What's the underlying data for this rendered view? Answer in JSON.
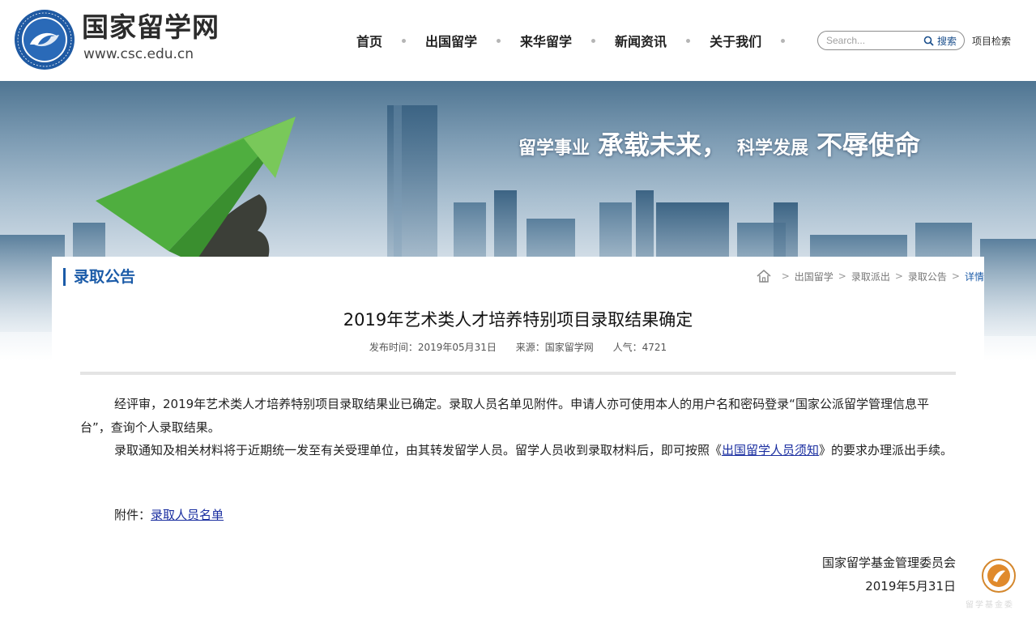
{
  "header": {
    "logo_title": "国家留学网",
    "logo_url": "www.csc.edu.cn",
    "nav": [
      "首页",
      "出国留学",
      "来华留学",
      "新闻资讯",
      "关于我们"
    ],
    "search": {
      "placeholder": "Search...",
      "button_label": "搜索"
    },
    "project_search": "项目检索"
  },
  "banner": {
    "slogan_1_small": "留学事业",
    "slogan_1_big": "承载未来，",
    "slogan_2_small": "科学发展",
    "slogan_2_big": "不辱使命"
  },
  "section": {
    "title": "录取公告",
    "breadcrumb": [
      "出国留学",
      "录取派出",
      "录取公告"
    ],
    "breadcrumb_current": "详情"
  },
  "article": {
    "title": "2019年艺术类人才培养特别项目录取结果确定",
    "meta": {
      "date": "发布时间：2019年05月31日",
      "source": "来源：国家留学网",
      "views": "人气：4721"
    },
    "p1": "经评审，2019年艺术类人才培养特别项目录取结果业已确定。录取人员名单见附件。申请人亦可使用本人的用户名和密码登录“国家公派留学管理信息平台”，查询个人录取结果。",
    "p2_before": "录取通知及相关材料将于近期统一发至有关受理单位，由其转发留学人员。留学人员收到录取材料后，即可按照《",
    "p2_link": "出国留学人员须知",
    "p2_after": "》的要求办理派出手续。",
    "attachment_label": "附件：",
    "attachment_link": "录取人员名单",
    "sign_org": "国家留学基金管理委员会",
    "sign_date": "2019年5月31日"
  },
  "corner": {
    "text": "留学基金委"
  }
}
